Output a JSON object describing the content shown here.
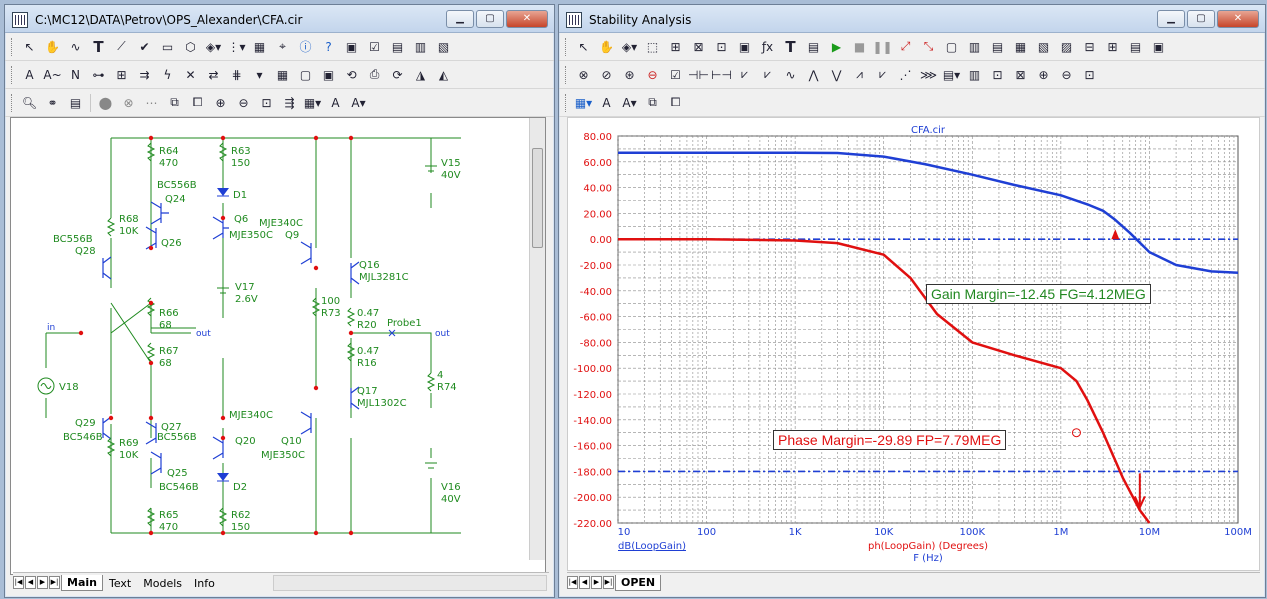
{
  "left_window": {
    "title": "C:\\MC12\\DATA\\Petrov\\OPS_Alexander\\CFA.cir",
    "tabs": [
      "Main",
      "Text",
      "Models",
      "Info"
    ],
    "active_tab": "Main",
    "components": [
      {
        "name": "R64",
        "value": "470"
      },
      {
        "name": "R63",
        "value": "150"
      },
      {
        "name": "D1",
        "value": ""
      },
      {
        "name": "Q24",
        "value": "BC556B"
      },
      {
        "name": "Q6",
        "value": "MJE350C"
      },
      {
        "name": "R68",
        "value": "10K"
      },
      {
        "name": "Q26",
        "value": ""
      },
      {
        "name": "Q28",
        "value": "BC556B"
      },
      {
        "name": "Q9",
        "value": "MJE340C"
      },
      {
        "name": "Q16",
        "value": "MJL3281C"
      },
      {
        "name": "V15",
        "value": "40V"
      },
      {
        "name": "V17",
        "value": "2.6V"
      },
      {
        "name": "R66",
        "value": "68"
      },
      {
        "name": "R67",
        "value": "68"
      },
      {
        "name": "R73",
        "value": "100"
      },
      {
        "name": "R20",
        "value": "0.47"
      },
      {
        "name": "R16",
        "value": "0.47"
      },
      {
        "name": "R74",
        "value": "4"
      },
      {
        "name": "V18",
        "value": ""
      },
      {
        "name": "Q17",
        "value": "MJL1302C"
      },
      {
        "name": "Q29",
        "value": "BC546B"
      },
      {
        "name": "R69",
        "value": "10K"
      },
      {
        "name": "Q27",
        "value": "BC556B"
      },
      {
        "name": "Q20",
        "value": "MJE340C"
      },
      {
        "name": "Q10",
        "value": "MJE350C"
      },
      {
        "name": "Q25",
        "value": "BC546B"
      },
      {
        "name": "D2",
        "value": ""
      },
      {
        "name": "R65",
        "value": "470"
      },
      {
        "name": "R62",
        "value": "150"
      },
      {
        "name": "V16",
        "value": "40V"
      }
    ],
    "node_labels": {
      "in": "in",
      "out1": "out",
      "out2": "out",
      "probe": "Probe1"
    }
  },
  "right_window": {
    "title": "Stability Analysis",
    "tabs": [
      "OPEN"
    ],
    "active_tab": "OPEN",
    "plot_title": "CFA.cir",
    "gain_margin_label": "Gain Margin=-12.45 FG=4.12MEG",
    "phase_margin_label": "Phase Margin=-29.89 FP=7.79MEG",
    "x_axis_title": "F (Hz)",
    "legend_gain": "dB(LoopGain)",
    "legend_phase": "ph(LoopGain) (Degrees)",
    "colors": {
      "gain": "#1f3fd4",
      "phase": "#e01010",
      "grid": "#8a8a8a",
      "label_text": "#228822"
    }
  },
  "chart_data": {
    "type": "line",
    "title": "CFA.cir",
    "xlabel": "F (Hz)",
    "xscale": "log",
    "xlim": [
      10,
      100000000
    ],
    "ylim": [
      -220,
      80
    ],
    "x_ticks": [
      "10",
      "100",
      "1K",
      "10K",
      "100K",
      "1M",
      "10M",
      "100M"
    ],
    "y_ticks": [
      "80.00",
      "60.00",
      "40.00",
      "20.00",
      "0.00",
      "-20.00",
      "-40.00",
      "-60.00",
      "-80.00",
      "-100.00",
      "-120.00",
      "-140.00",
      "-160.00",
      "-180.00",
      "-200.00",
      "-220.00"
    ],
    "series": [
      {
        "name": "dB(LoopGain)",
        "color": "#1f3fd4",
        "x": [
          10,
          100,
          1000,
          3000,
          10000,
          30000,
          100000,
          300000,
          1000000,
          2000000,
          3000000,
          4120000,
          6000000,
          10000000,
          20000000,
          50000000,
          100000000
        ],
        "y": [
          67,
          67,
          67,
          66.8,
          64,
          58,
          50,
          42,
          34,
          27,
          22,
          15,
          5,
          -10,
          -20,
          -25,
          -26
        ]
      },
      {
        "name": "ph(LoopGain) (Degrees)",
        "color": "#e01010",
        "x": [
          10,
          100,
          1000,
          3000,
          10000,
          20000,
          40000,
          100000,
          300000,
          1000000,
          1500000,
          2000000,
          3000000,
          5000000,
          7790000,
          10000000
        ],
        "y": [
          0,
          0,
          -1,
          -3,
          -12,
          -30,
          -58,
          -80,
          -90,
          -100,
          -110,
          -125,
          -150,
          -185,
          -210,
          -220
        ]
      }
    ],
    "reference_lines": [
      {
        "y": 0,
        "color": "#1f3fd4"
      },
      {
        "y": -180,
        "color": "#1f3fd4"
      }
    ],
    "markers": [
      {
        "series": "gain",
        "x": 4120000,
        "y": 0
      },
      {
        "series": "phase",
        "x": 7790000,
        "y": -180
      }
    ],
    "grid": true
  }
}
